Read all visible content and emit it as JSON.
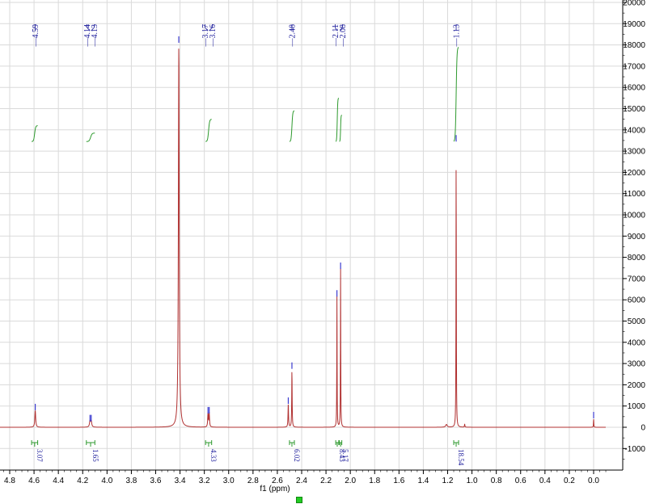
{
  "chart_data": {
    "type": "line",
    "xlabel": "f1 (ppm)",
    "ylabel": "",
    "xlim": [
      4.9,
      -0.1
    ],
    "ylim": [
      -1700,
      20000
    ],
    "x_ticks": [
      "4.8",
      "4.6",
      "4.4",
      "4.2",
      "4.0",
      "3.8",
      "3.6",
      "3.4",
      "3.2",
      "3.0",
      "2.8",
      "2.6",
      "2.4",
      "2.2",
      "2.0",
      "1.8",
      "1.6",
      "1.4",
      "1.2",
      "1.0",
      "0.8",
      "0.6",
      "0.4",
      "0.2",
      "0.0"
    ],
    "y_ticks": [
      "-1000",
      "0",
      "1000",
      "2000",
      "3000",
      "4000",
      "5000",
      "6000",
      "7000",
      "8000",
      "9000",
      "10000",
      "11000",
      "12000",
      "13000",
      "14000",
      "15000",
      "16000",
      "17000",
      "18000",
      "19000",
      "20000"
    ],
    "grid": true,
    "series": [
      {
        "peaks": [
          {
            "ppm": 4.59,
            "height": 800,
            "width": 0.008
          },
          {
            "ppm": 4.14,
            "height": 280,
            "width": 0.01
          },
          {
            "ppm": 4.13,
            "height": 280,
            "width": 0.01
          },
          {
            "ppm": 3.41,
            "height": 18100,
            "width": 0.008
          },
          {
            "ppm": 3.17,
            "height": 650,
            "width": 0.006
          },
          {
            "ppm": 3.16,
            "height": 650,
            "width": 0.006
          },
          {
            "ppm": 2.51,
            "height": 1100,
            "width": 0.005
          },
          {
            "ppm": 2.48,
            "height": 2750,
            "width": 0.004
          },
          {
            "ppm": 2.11,
            "height": 6150,
            "width": 0.003
          },
          {
            "ppm": 2.08,
            "height": 7450,
            "width": 0.003
          },
          {
            "ppm": 1.21,
            "height": 130,
            "width": 0.015
          },
          {
            "ppm": 1.13,
            "height": 13450,
            "width": 0.003
          },
          {
            "ppm": 1.06,
            "height": 150,
            "width": 0.004
          },
          {
            "ppm": 0.0,
            "height": 420,
            "width": 0.003
          }
        ]
      }
    ],
    "peak_labels": [
      {
        "ppm": 4.59,
        "text": "4.59"
      },
      {
        "ppm": 4.14,
        "text": "4.14"
      },
      {
        "ppm": 4.13,
        "text": "4.13"
      },
      {
        "ppm": 3.17,
        "text": "3.17"
      },
      {
        "ppm": 3.16,
        "text": "3.16"
      },
      {
        "ppm": 2.48,
        "text": "2.48"
      },
      {
        "ppm": 2.11,
        "text": "2.11"
      },
      {
        "ppm": 2.08,
        "text": "2.08"
      },
      {
        "ppm": 1.13,
        "text": "1.13"
      }
    ],
    "integrals": [
      {
        "from": 4.62,
        "to": 4.57,
        "value": "3.07",
        "y0": 13450,
        "y1": 14200
      },
      {
        "from": 4.17,
        "to": 4.1,
        "value": "1.65",
        "y0": 13450,
        "y1": 13850
      },
      {
        "from": 3.19,
        "to": 3.14,
        "value": "4.33",
        "y0": 13450,
        "y1": 14500
      },
      {
        "from": 2.5,
        "to": 2.46,
        "value": "6.02",
        "y0": 13450,
        "y1": 14900
      },
      {
        "from": 2.12,
        "to": 2.095,
        "value": "8.43",
        "y0": 13450,
        "y1": 15500
      },
      {
        "from": 2.09,
        "to": 2.07,
        "value": "5.17",
        "y0": 13450,
        "y1": 14700
      },
      {
        "from": 1.15,
        "to": 1.11,
        "value": "18.54",
        "y0": 13450,
        "y1": 17900
      }
    ]
  },
  "colors": {
    "spectrum": "#b03030",
    "integral": "#2e9a2e",
    "peak_marker": "#3b3bd0",
    "label": "#1a1a9a",
    "grid": "#dadada"
  },
  "status": {
    "indicator": "green-square"
  }
}
